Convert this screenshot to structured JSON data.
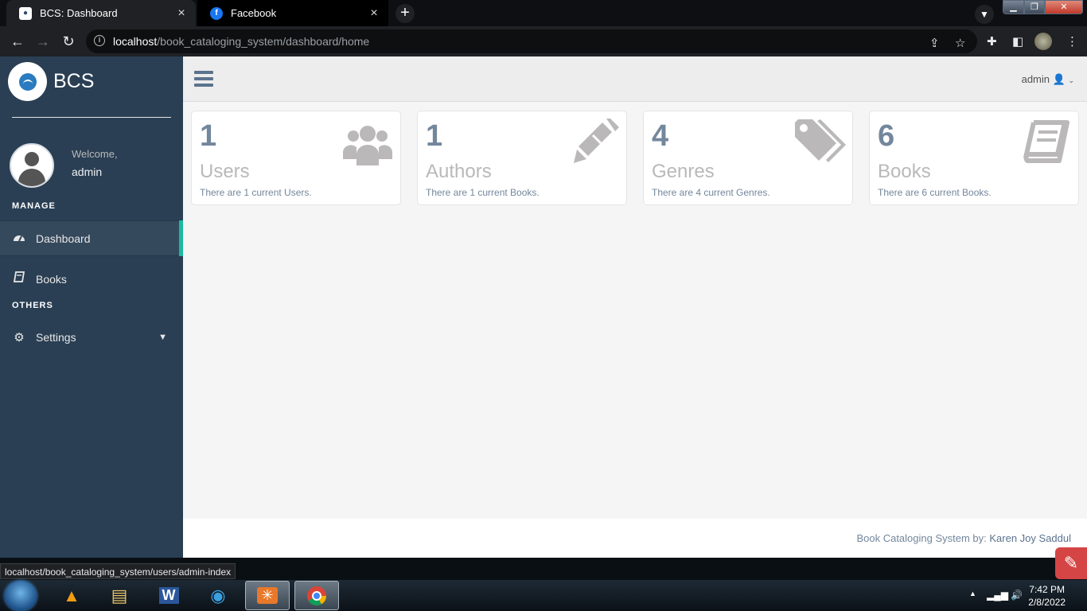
{
  "browser": {
    "tabs": [
      {
        "title": "BCS: Dashboard",
        "active": true,
        "favicon": "bcs-logo"
      },
      {
        "title": "Facebook",
        "active": false,
        "favicon": "facebook-logo"
      }
    ],
    "new_tab_symbol": "+",
    "close_symbol": "×",
    "url_host": "localhost",
    "url_path": "/book_cataloging_system/dashboard/home",
    "status_url": "localhost/book_cataloging_system/users/admin-index"
  },
  "sidebar": {
    "brand": "BCS",
    "welcome": "Welcome,",
    "user": "admin",
    "sections": {
      "manage": "MANAGE",
      "others": "OTHERS"
    },
    "items": [
      {
        "label": "Dashboard",
        "icon": "dashboard-gauge-icon",
        "active": true
      },
      {
        "label": "Books",
        "icon": "book-icon",
        "active": false
      },
      {
        "label": "Settings",
        "icon": "gear-icon",
        "active": false
      }
    ]
  },
  "topnav": {
    "user": "admin"
  },
  "cards": [
    {
      "count": "1",
      "label": "Users",
      "desc": "There are 1 current Users.",
      "icon": "users-icon"
    },
    {
      "count": "1",
      "label": "Authors",
      "desc": "There are 1 current Books.",
      "icon": "pencil-icon"
    },
    {
      "count": "4",
      "label": "Genres",
      "desc": "There are 4 current Genres.",
      "icon": "tags-icon"
    },
    {
      "count": "6",
      "label": "Books",
      "desc": "There are 6 current Books.",
      "icon": "book-icon"
    }
  ],
  "footer": {
    "prefix": "Book Cataloging System by: ",
    "author": "Karen Joy Saddul"
  },
  "taskbar": {
    "time": "7:42 PM",
    "date": "2/8/2022"
  },
  "colors": {
    "sidebar": "#2a3f54",
    "accent": "#1abb9c",
    "count": "#73879c"
  }
}
